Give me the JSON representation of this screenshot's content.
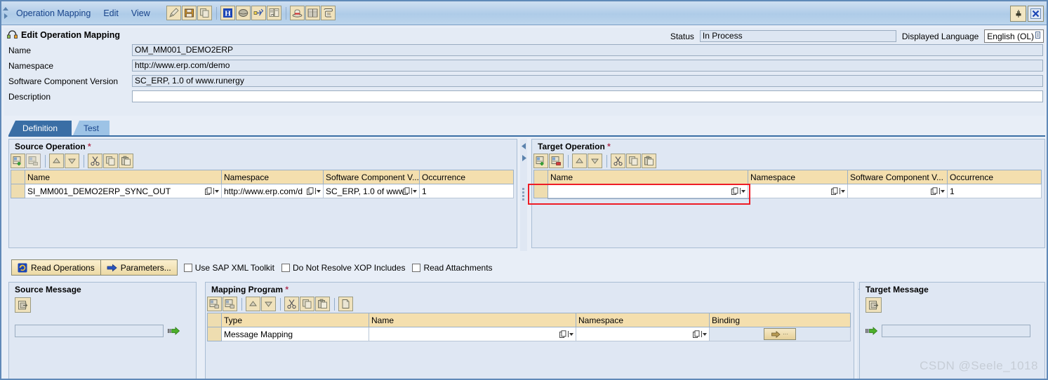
{
  "window": {
    "menu_items": [
      {
        "label": "Operation Mapping",
        "accel_index": 4
      },
      {
        "label": "Edit",
        "accel_index": 1
      },
      {
        "label": "View",
        "accel_index": 0
      }
    ],
    "toolbar_groups": [
      [
        "edit-pencil-icon",
        "save-floppy-icon",
        "copy-icon"
      ],
      [
        "info-icon",
        "book-icon",
        "network-arrows-icon",
        "compare-icon"
      ],
      [
        "hat-icon",
        "table-icon",
        "scroll-icon"
      ]
    ],
    "pin_button": "pin-icon",
    "close_button": "close-icon"
  },
  "header": {
    "title": "Edit Operation Mapping",
    "fields": [
      {
        "label": "Name",
        "value": "OM_MM001_DEMO2ERP",
        "readonly": true
      },
      {
        "label": "Namespace",
        "value": "http://www.erp.com/demo",
        "readonly": true
      },
      {
        "label": "Software Component Version",
        "value": "SC_ERP, 1.0 of www.runergy",
        "readonly": true
      },
      {
        "label": "Description",
        "value": "",
        "readonly": false
      }
    ],
    "status_label": "Status",
    "status_value": "In Process",
    "language_label": "Displayed Language",
    "language_value": "English (OL)"
  },
  "tabs": [
    {
      "label": "Definition",
      "selected": true
    },
    {
      "label": "Test",
      "selected": false
    }
  ],
  "source_operation": {
    "title": "Source Operation",
    "required": "*",
    "toolbar": [
      "insert-row-icon",
      "delete-row-icon",
      "move-up-icon",
      "move-down-icon",
      "cut-icon",
      "copy-icon",
      "paste-icon"
    ],
    "columns": [
      "Name",
      "Namespace",
      "Software Component V...",
      "Occurrence"
    ],
    "rows": [
      {
        "name": "SI_MM001_DEMO2ERP_SYNC_OUT",
        "namespace": "http://www.erp.com/d",
        "software_component_version": "SC_ERP, 1.0 of www",
        "occurrence": "1"
      }
    ]
  },
  "target_operation": {
    "title": "Target Operation",
    "required": "*",
    "toolbar": [
      "insert-row-icon",
      "delete-row-icon",
      "move-up-icon",
      "move-down-icon",
      "cut-icon",
      "copy-icon",
      "paste-icon"
    ],
    "columns": [
      "Name",
      "Namespace",
      "Software Component V...",
      "Occurrence"
    ],
    "rows": [
      {
        "name": "",
        "namespace": "",
        "software_component_version": "",
        "occurrence": "1"
      }
    ],
    "highlight_color": "#ee1c25"
  },
  "actions": {
    "read_operations": "Read Operations",
    "parameters": "Parameters...",
    "checkboxes": [
      {
        "label": "Use SAP XML Toolkit",
        "checked": false
      },
      {
        "label": "Do Not Resolve XOP Includes",
        "checked": false
      },
      {
        "label": "Read Attachments",
        "checked": false
      }
    ]
  },
  "source_message": {
    "title": "Source Message",
    "toolbar_icon": "open-document-icon",
    "value": ""
  },
  "mapping_program": {
    "title": "Mapping Program",
    "required": "*",
    "toolbar": [
      "insert-row-icon",
      "delete-row-icon",
      "move-up-icon",
      "move-down-icon",
      "cut-icon",
      "copy-icon",
      "paste-icon",
      "new-document-icon"
    ],
    "columns": [
      "Type",
      "Name",
      "Namespace",
      "Binding"
    ],
    "rows": [
      {
        "type": "Message Mapping",
        "name": "",
        "namespace": "",
        "binding_button": "binding-arrow-icon"
      }
    ]
  },
  "target_message": {
    "title": "Target Message",
    "toolbar_icon": "open-document-icon",
    "value": ""
  },
  "watermark": "CSDN @Seele_1018"
}
